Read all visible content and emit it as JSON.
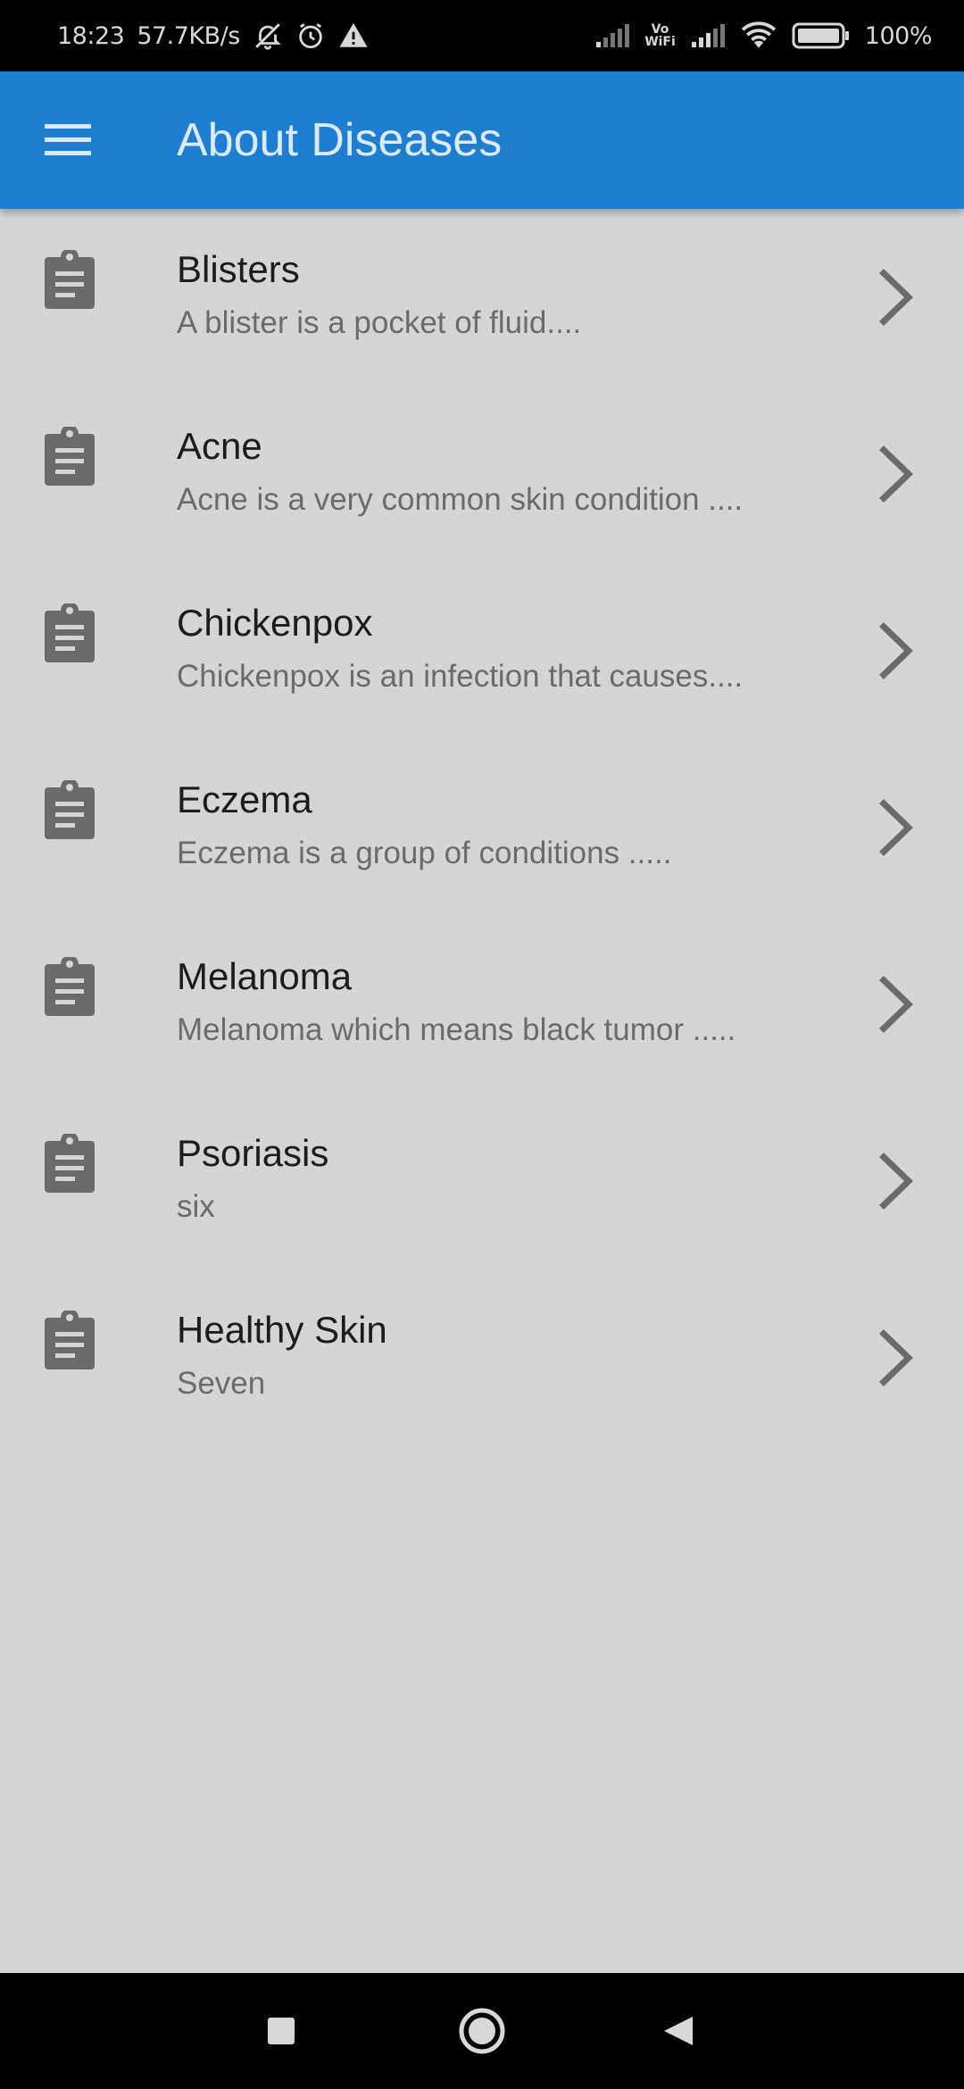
{
  "status_bar": {
    "time": "18:23",
    "speed": "57.7KB/s",
    "vowifi_top": "Vo",
    "vowifi_bottom": "WiFi",
    "battery": "100%",
    "icons": [
      "bell-off-icon",
      "alarm-icon",
      "warning-icon",
      "signal-icon",
      "vowifi-icon",
      "signal-icon",
      "wifi-icon",
      "battery-icon"
    ]
  },
  "app_bar": {
    "title": "About Diseases",
    "menu_icon": "hamburger-menu-icon",
    "color": "#1e7fd2"
  },
  "diseases": [
    {
      "title": "Blisters",
      "subtitle": "A blister is a pocket of fluid...."
    },
    {
      "title": "Acne",
      "subtitle": "Acne is a very common skin condition ...."
    },
    {
      "title": "Chickenpox",
      "subtitle": "Chickenpox is an infection that causes...."
    },
    {
      "title": "Eczema",
      "subtitle": "Eczema is a group of conditions ....."
    },
    {
      "title": "Melanoma",
      "subtitle": "Melanoma which means black tumor ....."
    },
    {
      "title": "Psoriasis",
      "subtitle": "six"
    },
    {
      "title": "Healthy Skin",
      "subtitle": "Seven"
    }
  ],
  "item_icons": {
    "leading": "clipboard-icon",
    "trailing": "chevron-right-icon"
  },
  "nav_bar": {
    "icons": [
      "recents-square-icon",
      "home-circle-icon",
      "back-triangle-icon"
    ]
  }
}
